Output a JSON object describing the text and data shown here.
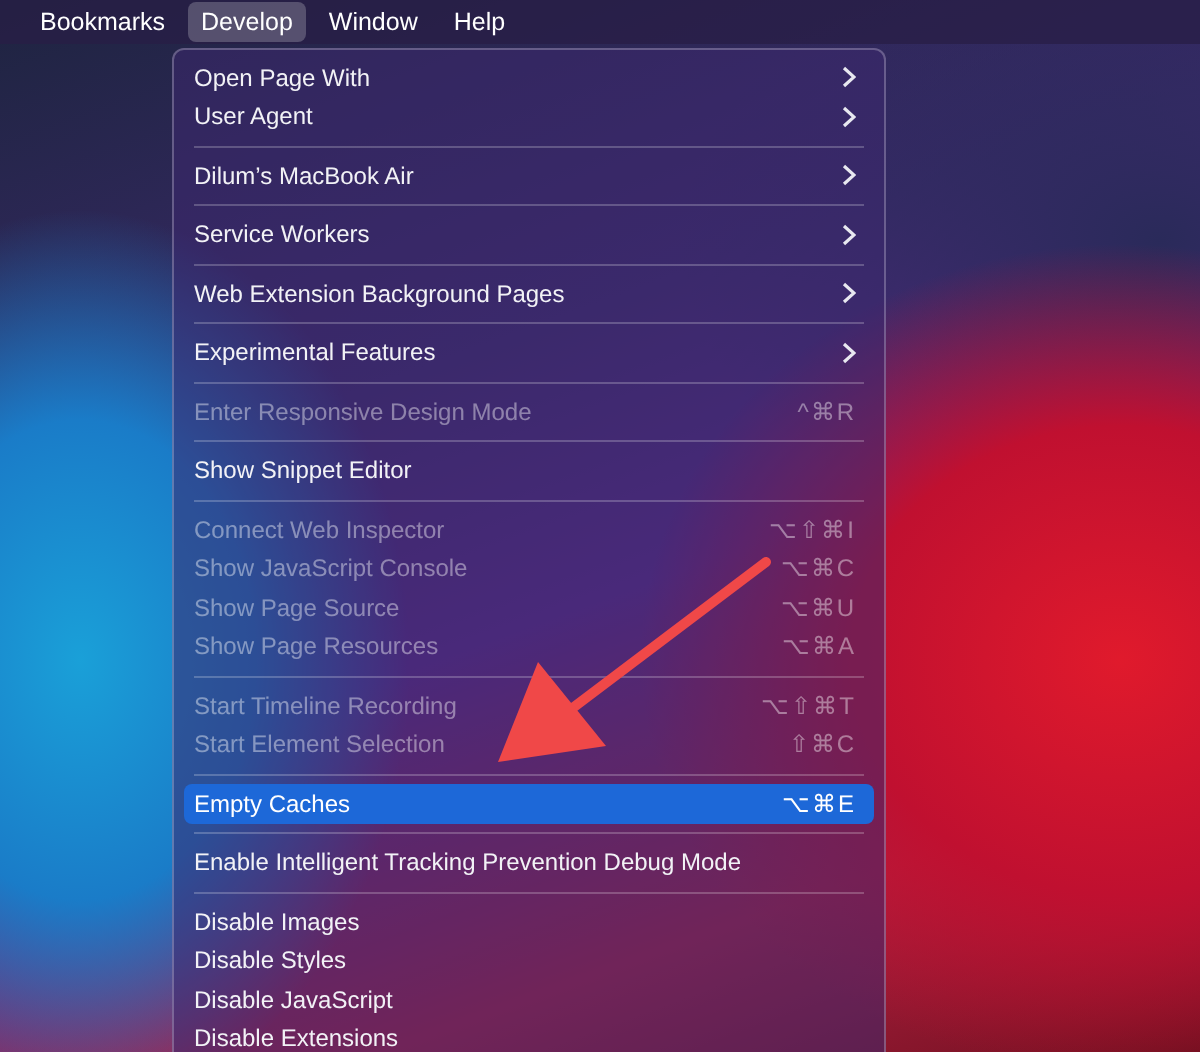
{
  "menu_bar": [
    {
      "label": "Bookmarks",
      "selected": false
    },
    {
      "label": "Develop",
      "selected": true
    },
    {
      "label": "Window",
      "selected": false
    },
    {
      "label": "Help",
      "selected": false
    }
  ],
  "develop_menu": {
    "groups": [
      {
        "items": [
          {
            "label": "Open Page With",
            "submenu": true,
            "disabled": false,
            "selected": false
          },
          {
            "label": "User Agent",
            "submenu": true,
            "disabled": false,
            "selected": false
          }
        ]
      },
      {
        "items": [
          {
            "label": "Dilum’s MacBook Air",
            "submenu": true,
            "disabled": false,
            "selected": false
          }
        ]
      },
      {
        "items": [
          {
            "label": "Service Workers",
            "submenu": true,
            "disabled": false,
            "selected": false
          }
        ]
      },
      {
        "items": [
          {
            "label": "Web Extension Background Pages",
            "submenu": true,
            "disabled": false,
            "selected": false
          }
        ]
      },
      {
        "items": [
          {
            "label": "Experimental Features",
            "submenu": true,
            "disabled": false,
            "selected": false
          }
        ]
      },
      {
        "items": [
          {
            "label": "Enter Responsive Design Mode",
            "shortcut": "^⌘R",
            "submenu": false,
            "disabled": true,
            "selected": false
          }
        ]
      },
      {
        "items": [
          {
            "label": "Show Snippet Editor",
            "submenu": false,
            "disabled": false,
            "selected": false
          }
        ]
      },
      {
        "items": [
          {
            "label": "Connect Web Inspector",
            "shortcut": "⌥⇧⌘I",
            "submenu": false,
            "disabled": true,
            "selected": false
          },
          {
            "label": "Show JavaScript Console",
            "shortcut": "⌥⌘C",
            "submenu": false,
            "disabled": true,
            "selected": false
          },
          {
            "label": "Show Page Source",
            "shortcut": "⌥⌘U",
            "submenu": false,
            "disabled": true,
            "selected": false
          },
          {
            "label": "Show Page Resources",
            "shortcut": "⌥⌘A",
            "submenu": false,
            "disabled": true,
            "selected": false
          }
        ]
      },
      {
        "items": [
          {
            "label": "Start Timeline Recording",
            "shortcut": "⌥⇧⌘T",
            "submenu": false,
            "disabled": true,
            "selected": false
          },
          {
            "label": "Start Element Selection",
            "shortcut": "⇧⌘C",
            "submenu": false,
            "disabled": true,
            "selected": false
          }
        ]
      },
      {
        "items": [
          {
            "label": "Empty Caches",
            "shortcut": "⌥⌘E",
            "submenu": false,
            "disabled": false,
            "selected": true
          }
        ]
      },
      {
        "items": [
          {
            "label": "Enable Intelligent Tracking Prevention Debug Mode",
            "submenu": false,
            "disabled": false,
            "selected": false
          }
        ]
      },
      {
        "items": [
          {
            "label": "Disable Images",
            "submenu": false,
            "disabled": false,
            "selected": false
          },
          {
            "label": "Disable Styles",
            "submenu": false,
            "disabled": false,
            "selected": false
          },
          {
            "label": "Disable JavaScript",
            "submenu": false,
            "disabled": false,
            "selected": false
          },
          {
            "label": "Disable Extensions",
            "submenu": false,
            "disabled": false,
            "selected": false
          }
        ]
      }
    ]
  }
}
